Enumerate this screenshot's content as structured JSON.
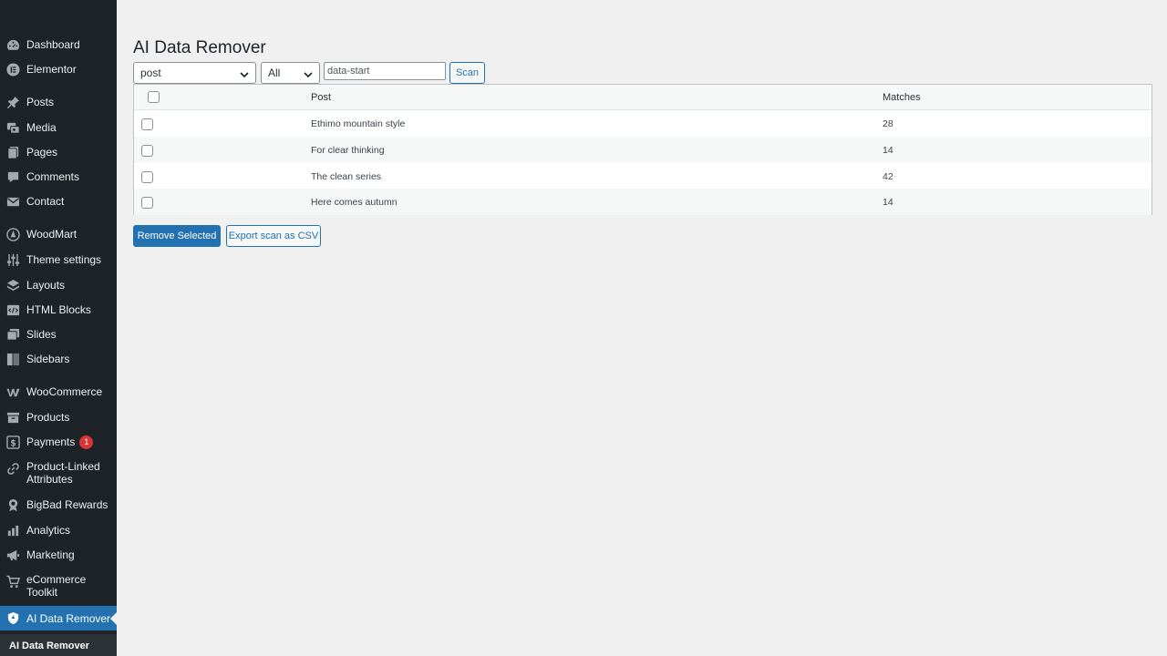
{
  "sidebar": {
    "items": [
      {
        "label": "Dashboard",
        "icon": "dashboard-icon"
      },
      {
        "label": "Elementor",
        "icon": "elementor-icon"
      },
      {
        "label": "Posts",
        "icon": "pin-icon"
      },
      {
        "label": "Media",
        "icon": "media-icon"
      },
      {
        "label": "Pages",
        "icon": "pages-icon"
      },
      {
        "label": "Comments",
        "icon": "comments-icon"
      },
      {
        "label": "Contact",
        "icon": "mail-icon"
      },
      {
        "label": "WoodMart",
        "icon": "woodmart-icon"
      },
      {
        "label": "Theme settings",
        "icon": "sliders-icon"
      },
      {
        "label": "Layouts",
        "icon": "layers-icon"
      },
      {
        "label": "HTML Blocks",
        "icon": "html-blocks-icon"
      },
      {
        "label": "Slides",
        "icon": "slides-icon"
      },
      {
        "label": "Sidebars",
        "icon": "sidebars-icon"
      },
      {
        "label": "WooCommerce",
        "icon": "woocommerce-icon"
      },
      {
        "label": "Products",
        "icon": "archive-icon"
      },
      {
        "label": "Payments",
        "icon": "dollar-icon",
        "badge": "1"
      },
      {
        "label": "Product-Linked Attributes",
        "icon": "link-icon"
      },
      {
        "label": "BigBad Rewards",
        "icon": "award-icon"
      },
      {
        "label": "Analytics",
        "icon": "bar-chart-icon"
      },
      {
        "label": "Marketing",
        "icon": "megaphone-icon"
      },
      {
        "label": "eCommerce Toolkit",
        "icon": "cart-icon"
      },
      {
        "label": "AI Data Remover",
        "icon": "shield-icon",
        "current": true
      }
    ],
    "submenu_current": "AI Data Remover"
  },
  "page": {
    "title": "AI Data Remover",
    "post_type_select": "post",
    "status_select": "All",
    "search_value": "data-start",
    "scan_label": "Scan",
    "columns": {
      "post": "Post",
      "matches": "Matches"
    },
    "rows": [
      {
        "post": "Ethimo mountain style",
        "matches": "28"
      },
      {
        "post": "For clear thinking",
        "matches": "14"
      },
      {
        "post": "The clean series",
        "matches": "42"
      },
      {
        "post": "Here comes autumn",
        "matches": "14"
      }
    ],
    "remove_label": "Remove Selected",
    "export_label": "Export scan as CSV"
  },
  "colors": {
    "sidebar_bg": "#1d2327",
    "accent": "#2271b1",
    "badge": "#d63638",
    "page_bg": "#f0f0f1"
  }
}
